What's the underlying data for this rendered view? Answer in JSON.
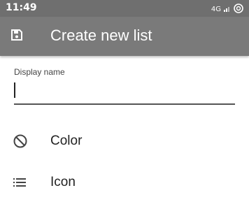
{
  "status_bar": {
    "time": "11:49",
    "network": "4G"
  },
  "app_bar": {
    "title": "Create new list",
    "save_icon": "save-icon"
  },
  "form": {
    "display_name_label": "Display name",
    "display_name_value": ""
  },
  "options": [
    {
      "label": "Color",
      "icon": "block-icon"
    },
    {
      "label": "Icon",
      "icon": "list-icon"
    }
  ],
  "colors": {
    "status_bar": "#6f6f6f",
    "app_bar": "#7a7a7a",
    "text": "#222222"
  }
}
